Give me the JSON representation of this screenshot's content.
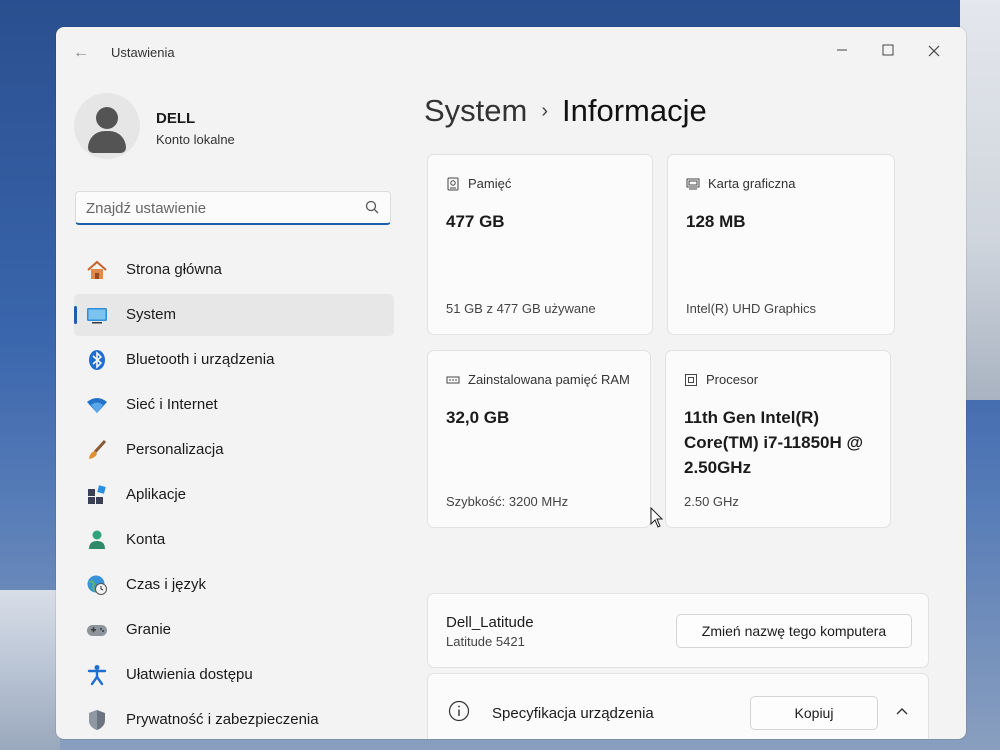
{
  "window": {
    "title": "Ustawienia"
  },
  "user": {
    "name": "DELL",
    "account_type": "Konto lokalne"
  },
  "search": {
    "placeholder": "Znajdź ustawienie"
  },
  "sidebar": {
    "items": [
      {
        "label": "Strona główna",
        "icon": "home-icon"
      },
      {
        "label": "System",
        "icon": "system-icon",
        "active": true
      },
      {
        "label": "Bluetooth i urządzenia",
        "icon": "bluetooth-icon"
      },
      {
        "label": "Sieć i Internet",
        "icon": "wifi-icon"
      },
      {
        "label": "Personalizacja",
        "icon": "brush-icon"
      },
      {
        "label": "Aplikacje",
        "icon": "apps-icon"
      },
      {
        "label": "Konta",
        "icon": "account-icon"
      },
      {
        "label": "Czas i język",
        "icon": "globe-clock-icon"
      },
      {
        "label": "Granie",
        "icon": "gamepad-icon"
      },
      {
        "label": "Ułatwienia dostępu",
        "icon": "accessibility-icon"
      },
      {
        "label": "Prywatność i zabezpieczenia",
        "icon": "shield-icon"
      }
    ]
  },
  "breadcrumb": {
    "parent": "System",
    "separator": "›",
    "current": "Informacje"
  },
  "cards": {
    "storage": {
      "title": "Pamięć",
      "value": "477 GB",
      "sub": "51 GB z 477 GB używane"
    },
    "gpu": {
      "title": "Karta graficzna",
      "value": "128 MB",
      "sub": "Intel(R) UHD Graphics"
    },
    "ram": {
      "title": "Zainstalowana pamięć RAM",
      "value": "32,0 GB",
      "sub": "Szybkość: 3200 MHz"
    },
    "cpu": {
      "title": "Procesor",
      "value": "11th Gen Intel(R) Core(TM) i7-11850H @ 2.50GHz",
      "sub": "2.50 GHz"
    }
  },
  "device": {
    "name": "Dell_Latitude",
    "model": "Latitude 5421",
    "rename_label": "Zmień nazwę tego komputera"
  },
  "spec": {
    "title": "Specyfikacja urządzenia",
    "copy_label": "Kopiuj"
  },
  "colors": {
    "accent": "#1d5fa8",
    "window_bg": "#f3f3f3",
    "card_bg": "#fbfbfb"
  }
}
